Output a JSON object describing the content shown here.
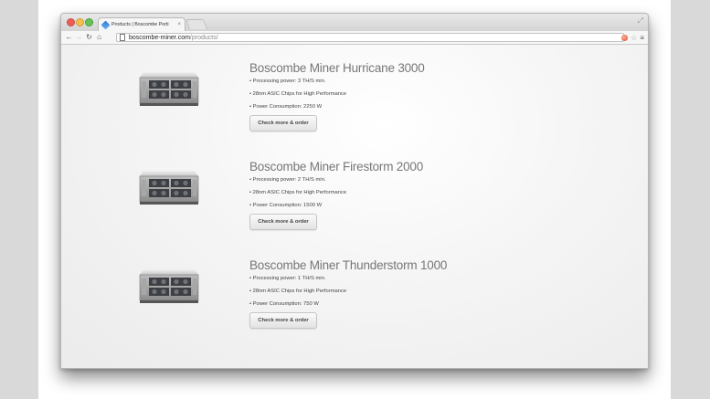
{
  "browser": {
    "tab_title": "Products | Boscombe Porti",
    "tab_close": "×",
    "url_host": "boscombe-miner.com",
    "url_path": "/products/"
  },
  "icons": {
    "back": "back-arrow-icon",
    "forward": "forward-arrow-icon",
    "reload": "reload-icon",
    "home": "home-icon",
    "extension": "extension-icon",
    "star": "star-icon",
    "menu": "menu-icon"
  },
  "products": [
    {
      "title": "Boscombe Miner Hurricane 3000",
      "specs": [
        "• Processing power: 3 TH/S min.",
        "• 28nm ASIC Chips for High Performance",
        "• Power Consumption: 2250 W"
      ],
      "button": "Check more & order"
    },
    {
      "title": "Boscombe Miner Firestorm 2000",
      "specs": [
        "• Processing power: 2 TH/S min.",
        "• 28nm ASIC Chips for High Performance",
        "• Power Consumption: 1500 W"
      ],
      "button": "Check more & order"
    },
    {
      "title": "Boscombe Miner Thunderstorm 1000",
      "specs": [
        "• Processing power: 1 TH/S min.",
        "• 28nm ASIC Chips for High Performance",
        "• Power Consumption: 750 W"
      ],
      "button": "Check more & order"
    }
  ]
}
